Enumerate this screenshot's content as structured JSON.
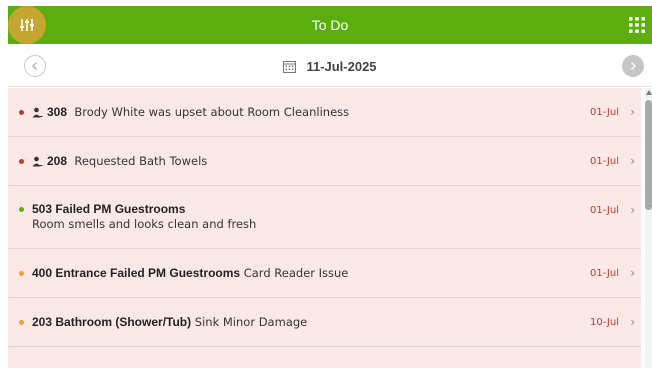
{
  "header": {
    "title": "To Do",
    "accent": "#5cae0f",
    "filter_icon": "sliders-icon",
    "menu_icon": "grid-icon"
  },
  "datebar": {
    "date": "11-Jul-2025",
    "calendar_icon": "calendar-icon"
  },
  "items": [
    {
      "status": "red",
      "assigned_icon": "person-icon",
      "bold": "308",
      "text": "Brody White was upset about Room Cleanliness",
      "date": "01-Jul"
    },
    {
      "status": "red",
      "assigned_icon": "person-icon",
      "bold": "208",
      "text": "Requested Bath Towels",
      "date": "01-Jul"
    },
    {
      "status": "green",
      "bold": "503 Failed PM Guestrooms",
      "text": "Room smells and looks clean and fresh",
      "date": "01-Jul"
    },
    {
      "status": "orange",
      "bold": "400 Entrance Failed PM Guestrooms",
      "text": "Card Reader Issue",
      "date": "01-Jul"
    },
    {
      "status": "orange",
      "bold": "203 Bathroom (Shower/Tub)",
      "text": "Sink Minor Damage",
      "date": "10-Jul"
    }
  ],
  "colors": {
    "red": "#c0392b",
    "green": "#5cae0f",
    "orange": "#f0a030",
    "row_bg": "#fde8e8"
  }
}
